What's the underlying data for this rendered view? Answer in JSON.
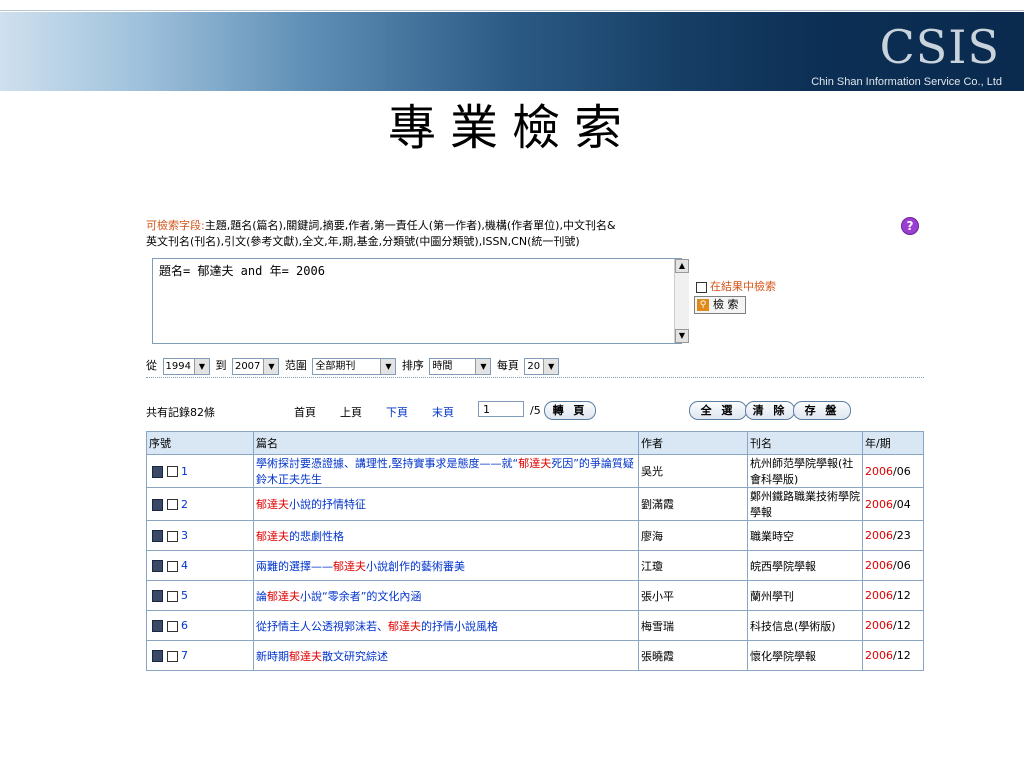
{
  "brand": {
    "logo": "CSIS",
    "company": "Chin Shan Information Service Co., Ltd"
  },
  "page_title": "專業檢索",
  "search": {
    "fields_label": "可檢索字段:",
    "fields_text_1": "主題,題名(篇名),關鍵詞,摘要,作者,第一責任人(第一作者),機構(作者單位),中文刊名&",
    "fields_text_2": "英文刊名(刊名),引文(參考文獻),全文,年,期,基金,分類號(中圖分類號),ISSN,CN(統一刊號)",
    "query": "題名= 郁達夫 and 年= 2006",
    "in_result_label": "在結果中檢索",
    "search_button": "檢 索",
    "help_icon": "?",
    "from_label": "從",
    "from_value": "1994",
    "to_label": "到",
    "to_value": "2007",
    "scope_label": "范圍",
    "scope_value": "全部期刊",
    "sort_label": "排序",
    "sort_value": "時間",
    "perpage_label": "每頁",
    "perpage_value": "20"
  },
  "pager": {
    "total": "共有記錄82條",
    "first": "首頁",
    "prev": "上頁",
    "next": "下頁",
    "last": "末頁",
    "page_input": "1",
    "page_total": "/5",
    "goto": "轉 頁",
    "select_all": "全 選",
    "clear": "清 除",
    "save": "存 盤"
  },
  "table": {
    "headers": [
      "序號",
      "篇名",
      "作者",
      "刊名",
      "年/期"
    ],
    "rows": [
      {
        "num": "1",
        "title_pre": "學術探討要憑證據、講理性,堅持實事求是態度——就“",
        "title_hl": "郁達夫",
        "title_post": "死因”的爭論質疑鈴木正夫先生",
        "author": "吳光",
        "journal": "杭州師范學院學報(社會科學版)",
        "year": "2006",
        "issue": "/06"
      },
      {
        "num": "2",
        "title_pre": "",
        "title_hl": "郁達夫",
        "title_post": "小說的抒情特征",
        "author": "劉滿霞",
        "journal": "鄭州鐵路職業技術學院學報",
        "year": "2006",
        "issue": "/04"
      },
      {
        "num": "3",
        "title_pre": "",
        "title_hl": "郁達夫",
        "title_post": "的悲劇性格",
        "author": "廖海",
        "journal": "職業時空",
        "year": "2006",
        "issue": "/23"
      },
      {
        "num": "4",
        "title_pre": "兩難的選擇——",
        "title_hl": "郁達夫",
        "title_post": "小說創作的藝術審美",
        "author": "江瓊",
        "journal": "皖西學院學報",
        "year": "2006",
        "issue": "/06"
      },
      {
        "num": "5",
        "title_pre": "論",
        "title_hl": "郁達夫",
        "title_post": "小說“零余者”的文化內涵",
        "author": "張小平",
        "journal": "蘭州學刊",
        "year": "2006",
        "issue": "/12"
      },
      {
        "num": "6",
        "title_pre": "從抒情主人公透視郭沫若、",
        "title_hl": "郁達夫",
        "title_post": "的抒情小說風格",
        "author": "梅雪瑞",
        "journal": "科技信息(學術版)",
        "year": "2006",
        "issue": "/12"
      },
      {
        "num": "7",
        "title_pre": "新時期",
        "title_hl": "郁達夫",
        "title_post": "散文研究綜述",
        "author": "張曉霞",
        "journal": "懷化學院學報",
        "year": "2006",
        "issue": "/12"
      }
    ]
  }
}
